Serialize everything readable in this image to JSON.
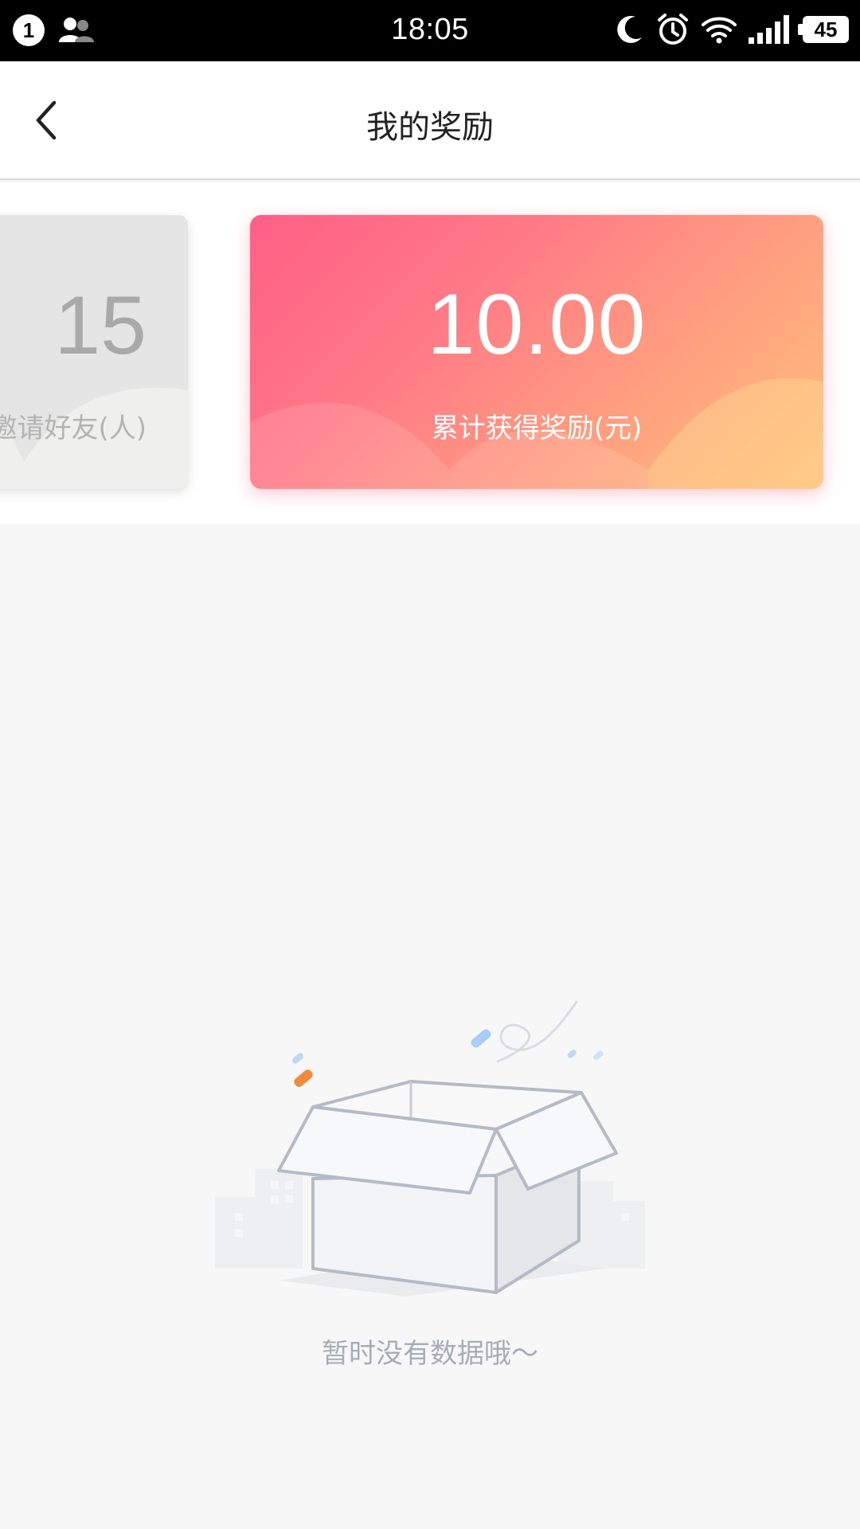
{
  "status_bar": {
    "notification_count": "1",
    "time": "18:05",
    "battery_level": "45",
    "icons": [
      "notification-badge-icon",
      "contacts-icon",
      "moon-icon",
      "alarm-icon",
      "wifi-icon",
      "signal-icon",
      "battery-icon"
    ]
  },
  "nav": {
    "title": "我的奖励",
    "back_icon": "chevron-left-icon"
  },
  "cards": {
    "invited": {
      "value": "15",
      "label": "邀请好友(人)"
    },
    "reward": {
      "value": "10.00",
      "label": "累计获得奖励(元)"
    }
  },
  "empty_state": {
    "message": "暂时没有数据哦～",
    "icon": "open-box-icon"
  },
  "colors": {
    "card_gradient_start": "#ff5f86",
    "card_gradient_end": "#ffc07a",
    "grey_card": "#e5e5e5",
    "empty_text": "#a6adb8"
  }
}
